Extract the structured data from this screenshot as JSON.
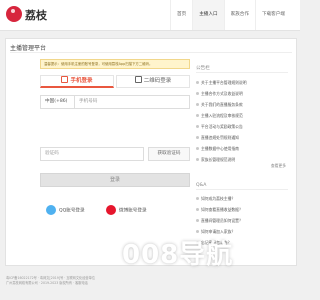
{
  "brand": {
    "name": "荔枝"
  },
  "nav": [
    "首页",
    "主播入口",
    "家族合作",
    "下载客户端"
  ],
  "page": {
    "title": "主播管理平台"
  },
  "notice": "温馨提示：使用手机注册的账号登录，可使用荔枝App扫描下方二维码。",
  "tabs": [
    "手机登录",
    "二维码登录"
  ],
  "form": {
    "country_code": "中国(+86)",
    "phone_placeholder": "手机号码",
    "code_placeholder": "验证码",
    "get_code": "获取验证码",
    "login": "登录"
  },
  "social": [
    "QQ账号登录",
    "微博账号登录"
  ],
  "announcements": {
    "title": "公告栏",
    "items": [
      "关于主播平台管理规则说明",
      "主播合作方式及收益说明",
      "关于我们的直播服务条款",
      "主播入驻流程及审核规范",
      "平台活动与奖励政策公告",
      "直播违规处罚规则通知",
      "主播数据中心使用指南",
      "家族长管理规范说明"
    ],
    "more": "查看更多"
  },
  "qa": {
    "title": "Q&A",
    "items": [
      "如何成为荔枝主播？",
      "如何查看直播收益数据？",
      "直播间管理员如何设置？",
      "如何申请加入家族？",
      "忘记密码怎么办？"
    ]
  },
  "footer": [
    "粤ICP备16022172号 · 粤网文[2019]号 · 互联网文化经营单位",
    "广州荔枝网络有限公司 · 2019-2023 版权所有 · 客服电话"
  ],
  "watermark": "008导航",
  "colors": {
    "brand": "#d7263d",
    "accent": "#e9573f"
  }
}
